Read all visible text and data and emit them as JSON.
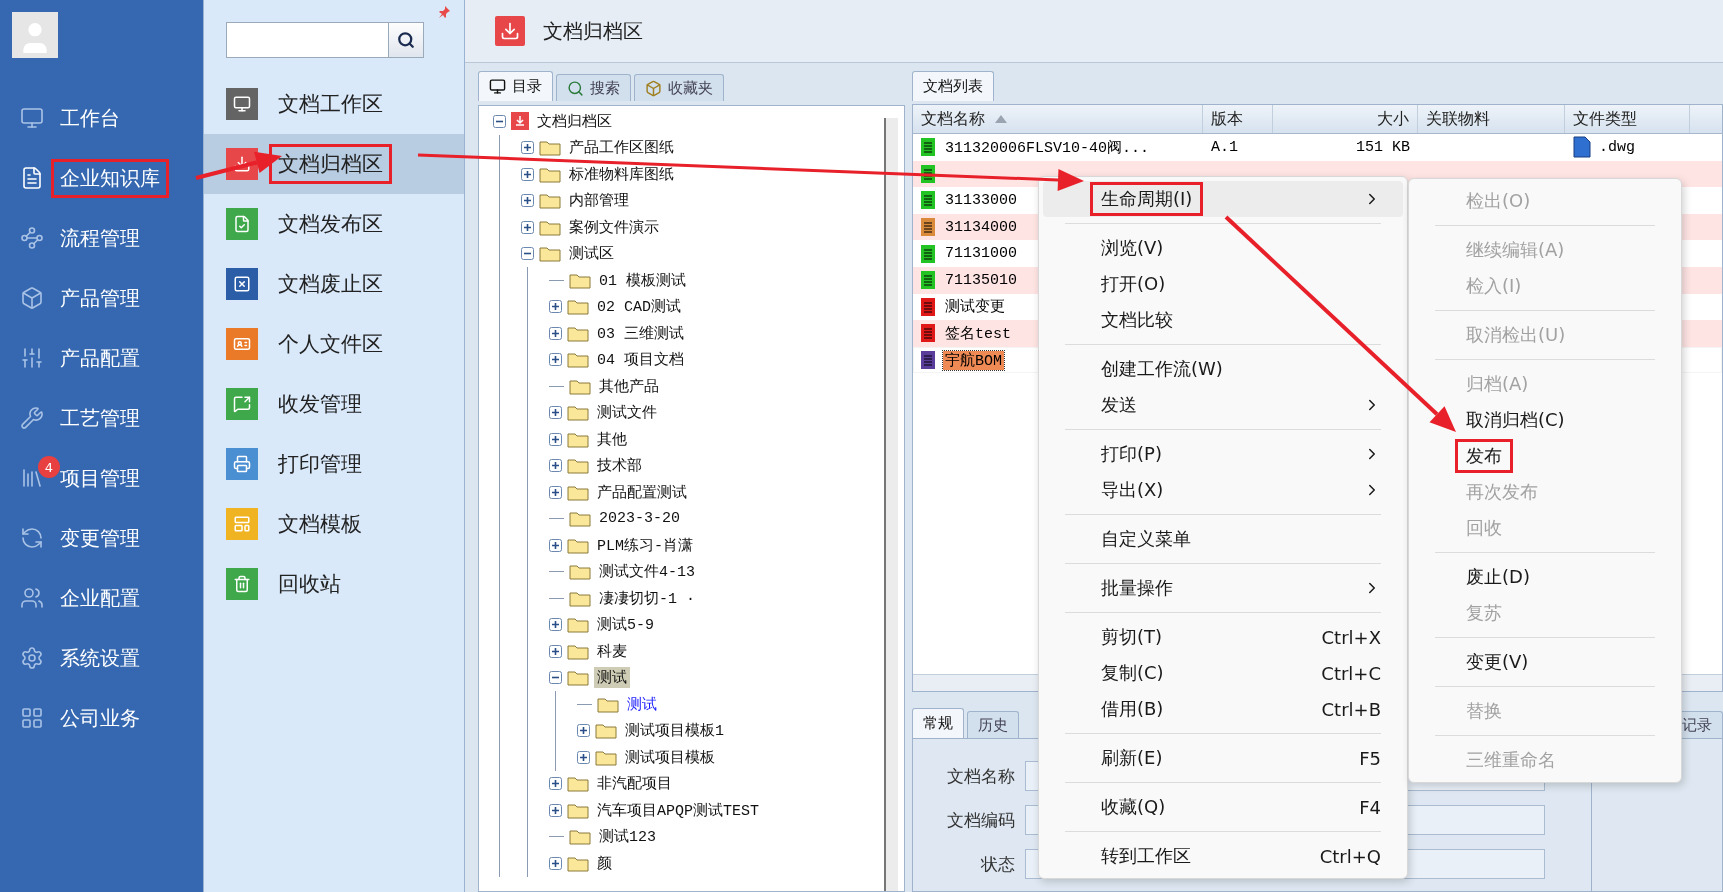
{
  "nav": {
    "items": [
      {
        "label": "工作台",
        "selected": false,
        "annotated": false
      },
      {
        "label": "企业知识库",
        "selected": true,
        "annotated": true
      },
      {
        "label": "流程管理",
        "selected": false,
        "annotated": false
      },
      {
        "label": "产品管理",
        "selected": false,
        "annotated": false
      },
      {
        "label": "产品配置",
        "selected": false,
        "annotated": false
      },
      {
        "label": "工艺管理",
        "selected": false,
        "annotated": false
      },
      {
        "label": "项目管理",
        "selected": false,
        "annotated": false,
        "badge": "4"
      },
      {
        "label": "变更管理",
        "selected": false,
        "annotated": false
      },
      {
        "label": "企业配置",
        "selected": false,
        "annotated": false
      },
      {
        "label": "系统设置",
        "selected": false,
        "annotated": false
      },
      {
        "label": "公司业务",
        "selected": false,
        "annotated": false
      }
    ]
  },
  "sub_nav": {
    "items": [
      {
        "label": "文档工作区",
        "color": "#646464",
        "selected": false,
        "annotated": false
      },
      {
        "label": "文档归档区",
        "color": "#e8474a",
        "selected": true,
        "annotated": true
      },
      {
        "label": "文档发布区",
        "color": "#3fa84b",
        "selected": false,
        "annotated": false
      },
      {
        "label": "文档废止区",
        "color": "#2c5ea8",
        "selected": false,
        "annotated": false
      },
      {
        "label": "个人文件区",
        "color": "#ea7a28",
        "selected": false,
        "annotated": false
      },
      {
        "label": "收发管理",
        "color": "#3fa84b",
        "selected": false,
        "annotated": false
      },
      {
        "label": "打印管理",
        "color": "#4a8fd2",
        "selected": false,
        "annotated": false
      },
      {
        "label": "文档模板",
        "color": "#f0b322",
        "selected": false,
        "annotated": false
      },
      {
        "label": "回收站",
        "color": "#3fa84b",
        "selected": false,
        "annotated": false
      }
    ]
  },
  "header": {
    "title": "文档归档区"
  },
  "tree_panel": {
    "tabs": [
      {
        "label": "目录",
        "selected": true
      },
      {
        "label": "搜索",
        "selected": false
      },
      {
        "label": "收藏夹",
        "selected": false
      }
    ],
    "tree": {
      "label": "文档归档区",
      "expanded": true,
      "selected": false,
      "children": [
        {
          "label": "产品工作区图纸",
          "expanded": false,
          "selected": false
        },
        {
          "label": "标准物料库图纸",
          "expanded": false,
          "selected": false
        },
        {
          "label": "内部管理",
          "expanded": false,
          "selected": false
        },
        {
          "label": "案例文件演示",
          "expanded": false,
          "selected": false
        },
        {
          "label": "测试区",
          "expanded": true,
          "selected": false,
          "children": [
            {
              "label": "01 模板测试",
              "selected": false
            },
            {
              "label": "02 CAD测试",
              "expanded": false,
              "selected": false
            },
            {
              "label": "03 三维测试",
              "expanded": false,
              "selected": false
            },
            {
              "label": "04 项目文档",
              "expanded": false,
              "selected": false
            },
            {
              "label": "其他产品",
              "selected": false
            },
            {
              "label": "测试文件",
              "expanded": false,
              "selected": false
            },
            {
              "label": "其他",
              "expanded": false,
              "selected": false
            },
            {
              "label": "技术部",
              "expanded": false,
              "selected": false
            },
            {
              "label": "产品配置测试",
              "expanded": false,
              "selected": false
            },
            {
              "label": "2023-3-20",
              "selected": false
            },
            {
              "label": "PLM练习-肖潇",
              "expanded": false,
              "selected": false
            },
            {
              "label": "测试文件4-13",
              "selected": false
            },
            {
              "label": "凄凄切切-1 ·",
              "selected": false
            },
            {
              "label": "测试5-9",
              "expanded": false,
              "selected": false
            },
            {
              "label": "科麦",
              "expanded": false,
              "selected": false
            },
            {
              "label": "测试",
              "expanded": true,
              "selected": true,
              "children": [
                {
                  "label": "测试",
                  "selected": false,
                  "hover": true
                },
                {
                  "label": "测试项目模板1",
                  "expanded": false,
                  "selected": false
                },
                {
                  "label": "测试项目模板",
                  "expanded": false,
                  "selected": false
                }
              ]
            },
            {
              "label": "非汽配项目",
              "expanded": false,
              "selected": false
            },
            {
              "label": "汽车项目APQP测试TEST",
              "expanded": false,
              "selected": false
            },
            {
              "label": "测试123",
              "selected": false
            },
            {
              "label": "颜",
              "expanded": false,
              "selected": false
            }
          ]
        }
      ]
    }
  },
  "document_list": {
    "tab": "文档列表",
    "columns": [
      {
        "label": "文档名称",
        "sorted": true
      },
      {
        "label": "版本"
      },
      {
        "label": "大小"
      },
      {
        "label": "关联物料"
      },
      {
        "label": "文件类型"
      }
    ],
    "rows": [
      {
        "name": "311320006FLSV10-40阀...",
        "version": "A.1",
        "size": "151 KB",
        "type": ".dwg",
        "color": "#22c322",
        "selected": false
      },
      {
        "color": "#22c322",
        "selected": false
      },
      {
        "name": "31133000",
        "color": "#22c322",
        "selected": false
      },
      {
        "name": "31134000",
        "color": "#d98a3a",
        "selected": false
      },
      {
        "name": "71131000",
        "color": "#22c322",
        "selected": false
      },
      {
        "name": "71135010",
        "color": "#22c322",
        "selected": false
      },
      {
        "name": "测试变更",
        "color": "#e01818",
        "selected": false
      },
      {
        "name": "签名test",
        "color": "#e01818",
        "selected": false
      },
      {
        "name": "宇航BOM",
        "color": "#5a3c9a",
        "selected": true
      }
    ]
  },
  "detail": {
    "tabs": [
      {
        "label": "常规",
        "selected": true
      },
      {
        "label": "历史",
        "selected": false
      },
      {
        "label": "记录",
        "selected": false
      }
    ],
    "fields": [
      {
        "label": "文档名称"
      },
      {
        "label": "文档编码"
      },
      {
        "label": "状态"
      }
    ]
  },
  "context_menu": {
    "items": [
      {
        "kind": "item",
        "label": "生命周期(I)",
        "submenu": true,
        "highlighted": true,
        "annotated": true
      },
      {
        "kind": "separator"
      },
      {
        "kind": "item",
        "label": "浏览(V)"
      },
      {
        "kind": "item",
        "label": "打开(O)"
      },
      {
        "kind": "item",
        "label": "文档比较"
      },
      {
        "kind": "separator"
      },
      {
        "kind": "item",
        "label": "创建工作流(W)"
      },
      {
        "kind": "item",
        "label": "发送",
        "submenu": true
      },
      {
        "kind": "separator"
      },
      {
        "kind": "item",
        "label": "打印(P)",
        "submenu": true
      },
      {
        "kind": "item",
        "label": "导出(X)",
        "submenu": true
      },
      {
        "kind": "separator"
      },
      {
        "kind": "item",
        "label": "自定义菜单"
      },
      {
        "kind": "separator"
      },
      {
        "kind": "item",
        "label": "批量操作",
        "submenu": true
      },
      {
        "kind": "separator"
      },
      {
        "kind": "item",
        "label": "剪切(T)",
        "shortcut": "Ctrl+X"
      },
      {
        "kind": "item",
        "label": "复制(C)",
        "shortcut": "Ctrl+C"
      },
      {
        "kind": "item",
        "label": "借用(B)",
        "shortcut": "Ctrl+B"
      },
      {
        "kind": "separator"
      },
      {
        "kind": "item",
        "label": "刷新(E)",
        "shortcut": "F5"
      },
      {
        "kind": "separator"
      },
      {
        "kind": "item",
        "label": "收藏(Q)",
        "shortcut": "F4"
      },
      {
        "kind": "separator"
      },
      {
        "kind": "item",
        "label": "转到工作区",
        "shortcut": "Ctrl+Q"
      }
    ]
  },
  "submenu": {
    "items": [
      {
        "kind": "item",
        "label": "检出(O)",
        "disabled": true
      },
      {
        "kind": "separator"
      },
      {
        "kind": "item",
        "label": "继续编辑(A)",
        "disabled": true
      },
      {
        "kind": "item",
        "label": "检入(I)",
        "disabled": true
      },
      {
        "kind": "separator"
      },
      {
        "kind": "item",
        "label": "取消检出(U)",
        "disabled": true
      },
      {
        "kind": "separator"
      },
      {
        "kind": "item",
        "label": "归档(A)",
        "disabled": true
      },
      {
        "kind": "item",
        "label": "取消归档(C)",
        "disabled": false
      },
      {
        "kind": "item",
        "label": "发布",
        "disabled": false,
        "annotated": true
      },
      {
        "kind": "item",
        "label": "再次发布",
        "disabled": true
      },
      {
        "kind": "item",
        "label": "回收",
        "disabled": true
      },
      {
        "kind": "separator"
      },
      {
        "kind": "item",
        "label": "废止(D)",
        "disabled": false
      },
      {
        "kind": "item",
        "label": "复苏",
        "disabled": true
      },
      {
        "kind": "separator"
      },
      {
        "kind": "item",
        "label": "变更(V)",
        "disabled": false
      },
      {
        "kind": "separator"
      },
      {
        "kind": "item",
        "label": "替换",
        "disabled": true
      },
      {
        "kind": "separator"
      },
      {
        "kind": "item",
        "label": "三维重命名",
        "disabled": true
      }
    ]
  }
}
